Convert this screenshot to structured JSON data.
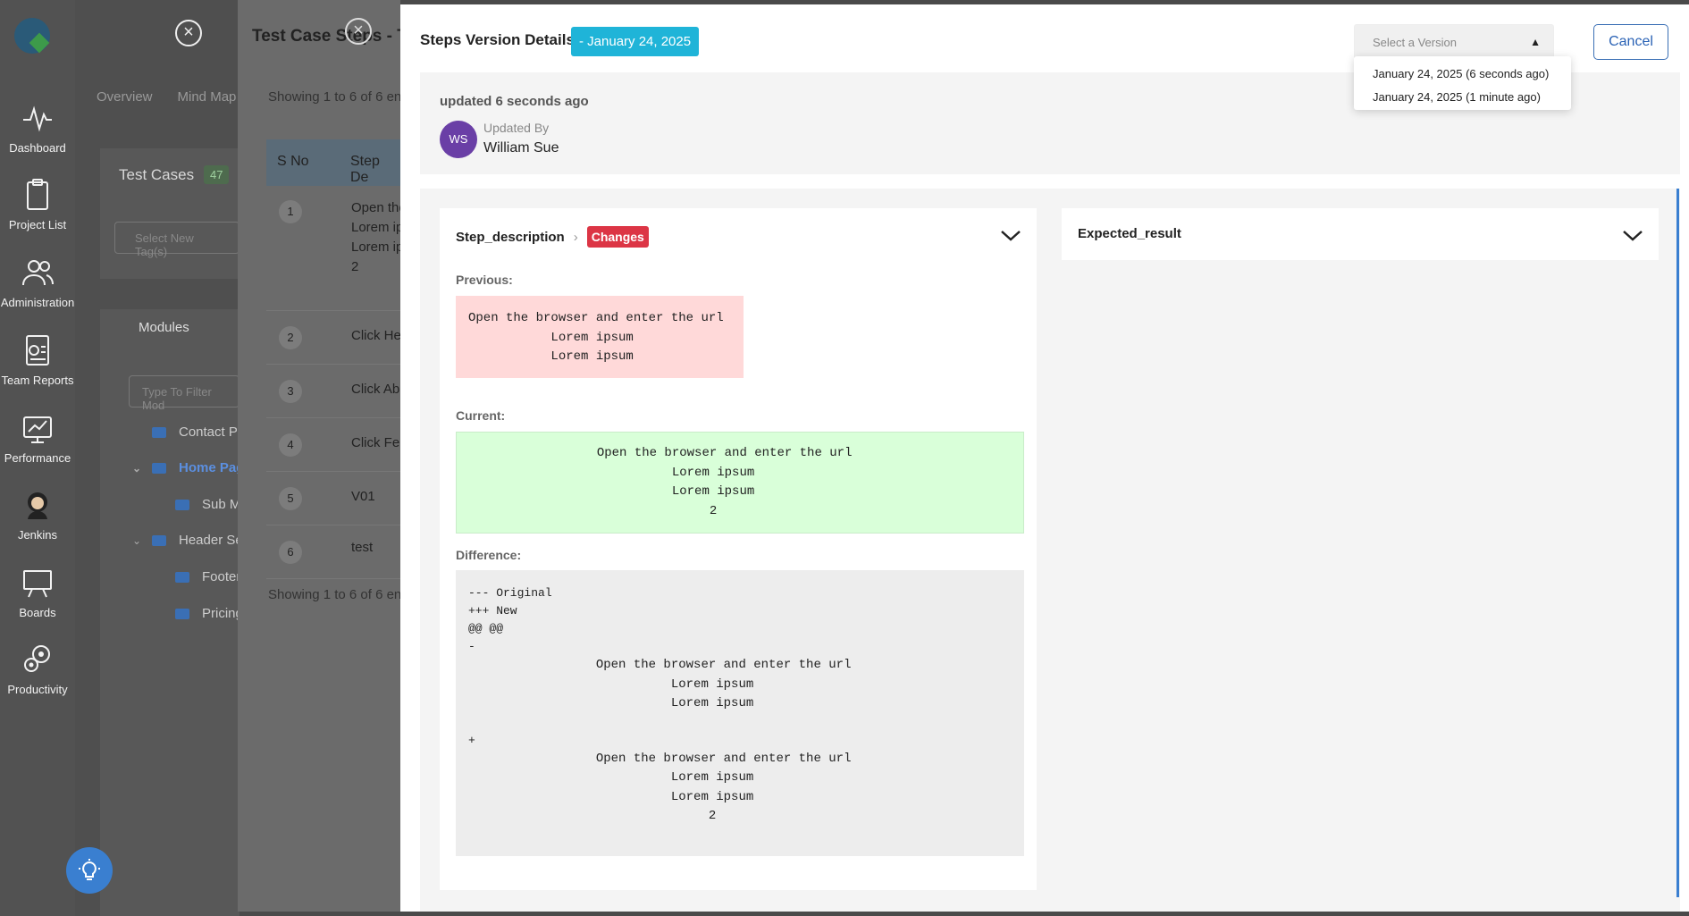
{
  "sidebar": {
    "items": [
      {
        "label": "Dashboard",
        "icon": "pulse-icon"
      },
      {
        "label": "Project List",
        "icon": "clipboard-icon"
      },
      {
        "label": "Administration",
        "icon": "users-icon"
      },
      {
        "label": "Team Reports",
        "icon": "report-icon"
      },
      {
        "label": "Performance",
        "icon": "performance-icon"
      },
      {
        "label": "Jenkins",
        "icon": "jenkins-icon"
      },
      {
        "label": "Boards",
        "icon": "board-icon"
      },
      {
        "label": "Productivity",
        "icon": "productivity-icon"
      }
    ]
  },
  "background": {
    "tabs": [
      "Overview",
      "Mind Map"
    ],
    "test_cases_title": "Test Cases",
    "test_cases_count": "47",
    "tag_placeholder": "Select New Tag(s)",
    "modules_title": "Modules",
    "filter_placeholder": "Type To Filter Mod",
    "tree": [
      {
        "label": "Contact Pa",
        "expanded": false,
        "active": false
      },
      {
        "label": "Home Pag",
        "expanded": true,
        "active": true
      },
      {
        "label": "Sub M",
        "expanded": false,
        "active": false
      },
      {
        "label": "Header Se",
        "expanded": true,
        "active": false
      },
      {
        "label": "Footer",
        "expanded": false,
        "active": false
      },
      {
        "label": "Pricing",
        "expanded": false,
        "active": false
      }
    ],
    "steps_panel": {
      "title": "Test Case Steps - T",
      "showing_top": "Showing 1 to 6 of 6 ent",
      "showing_bottom": "Showing 1 to 6 of 6 ent",
      "headers": [
        "S No",
        "Step De"
      ],
      "rows": [
        {
          "num": "1",
          "text": [
            "Open the",
            "Lorem ip",
            "Lorem ip",
            "2"
          ]
        },
        {
          "num": "2",
          "text": [
            "Click He"
          ]
        },
        {
          "num": "3",
          "text": [
            "Click Ab"
          ]
        },
        {
          "num": "4",
          "text": [
            "Click Fe"
          ]
        },
        {
          "num": "5",
          "text": [
            "V01"
          ]
        },
        {
          "num": "6",
          "text": [
            "test"
          ]
        }
      ]
    }
  },
  "modal": {
    "title": "Steps Version Details",
    "date_badge": "- January 24, 2025",
    "version_select": {
      "placeholder": "Select a Version",
      "options": [
        "January 24, 2025 (6 seconds ago)",
        "January 24, 2025 (1 minute ago)"
      ]
    },
    "cancel_label": "Cancel",
    "updated_text": "updated 6 seconds ago",
    "updated_by_label": "Updated By",
    "updated_by_initials": "WS",
    "updated_by_name": "William Sue",
    "step_card": {
      "field": "Step_description",
      "badge": "Changes",
      "previous_label": "Previous:",
      "previous_text": "Open the browser and enter the url\n           Lorem ipsum\n           Lorem ipsum",
      "current_label": "Current:",
      "current_text": "                 Open the browser and enter the url\n                           Lorem ipsum\n                           Lorem ipsum\n                                2",
      "difference_label": "Difference:",
      "diff_header": "--- Original\n+++ New\n@@ @@\n-",
      "diff_removed": "                 Open the browser and enter the url\n                           Lorem ipsum\n                           Lorem ipsum",
      "diff_plus": "+",
      "diff_added": "                 Open the browser and enter the url\n                           Lorem ipsum\n                           Lorem ipsum\n                                2"
    },
    "expected_card": {
      "field": "Expected_result"
    }
  },
  "colors": {
    "accent": "#1fb4d8",
    "changes": "#dc3545",
    "previous_bg": "#ffd9d9",
    "current_bg": "#d9ffd9",
    "avatar": "#6a3fa6",
    "primary": "#2a62b5"
  }
}
